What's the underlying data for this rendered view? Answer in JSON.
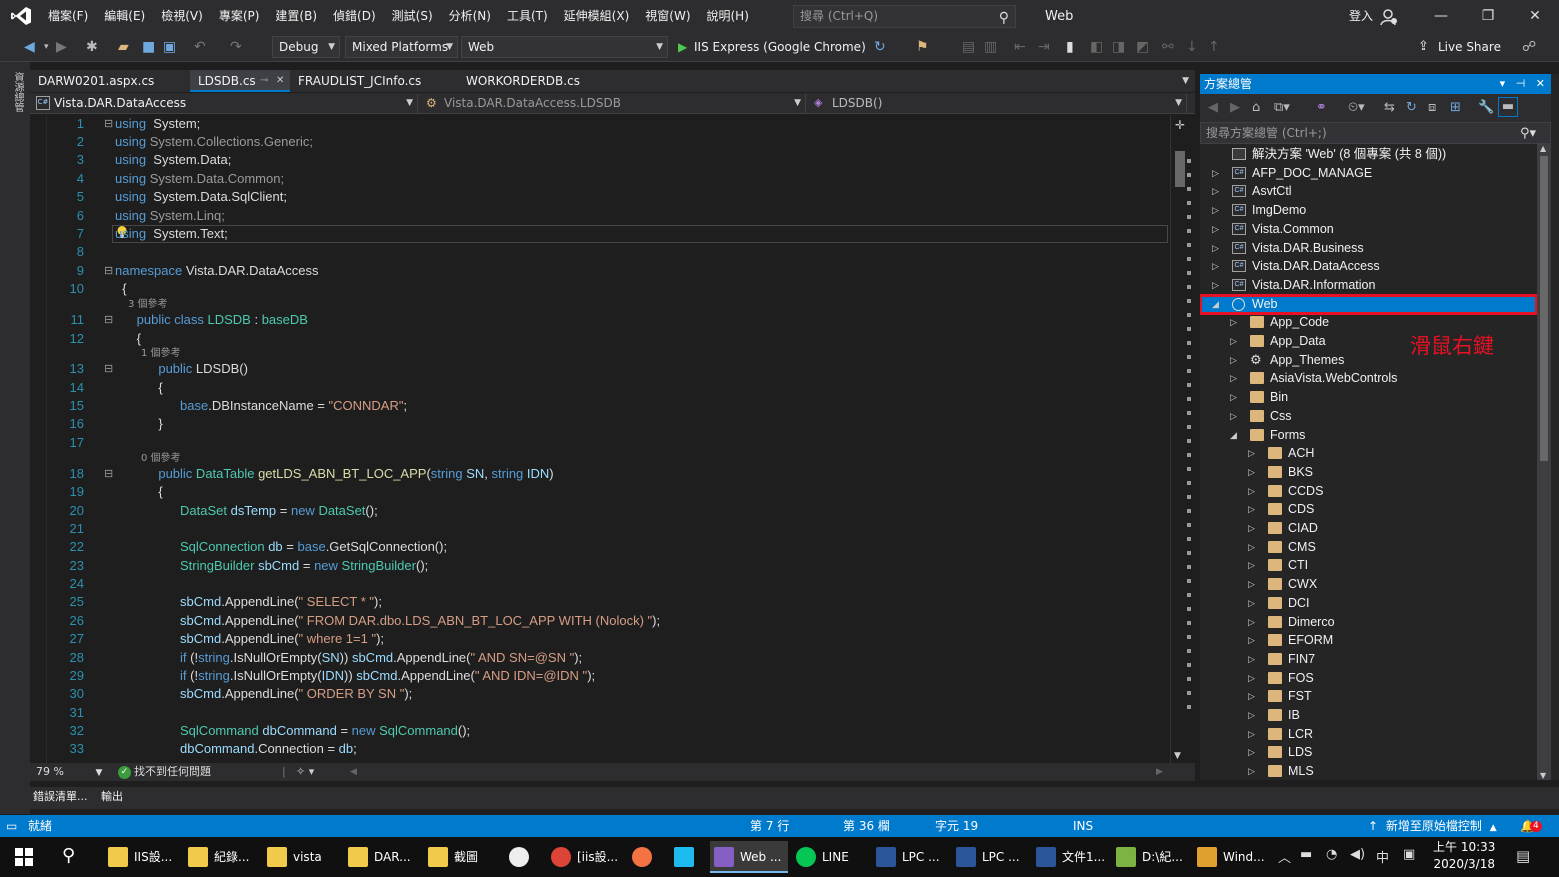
{
  "menubar": {
    "menus": [
      "檔案(F)",
      "編輯(E)",
      "檢視(V)",
      "專案(P)",
      "建置(B)",
      "偵錯(D)",
      "測試(S)",
      "分析(N)",
      "工具(T)",
      "延伸模組(X)",
      "視窗(W)",
      "說明(H)"
    ],
    "search_placeholder": "搜尋 (Ctrl+Q)",
    "solution_name": "Web",
    "signin_label": "登入"
  },
  "toolbar": {
    "config": "Debug",
    "platform": "Mixed Platforms",
    "startup_project": "Web",
    "run_label": "IIS Express (Google Chrome)",
    "liveshare_label": "Live Share"
  },
  "left_strip": {
    "toolbox_label": "資源總管"
  },
  "tabs": [
    {
      "label": "DARW0201.aspx.cs",
      "active": false
    },
    {
      "label": "LDSDB.cs",
      "active": true
    },
    {
      "label": "FRAUDLIST_JCInfo.cs",
      "active": false
    },
    {
      "label": "WORKORDERDB.cs",
      "active": false
    }
  ],
  "navbar": {
    "project": "Vista.DAR.DataAccess",
    "class": "Vista.DAR.DataAccess.LDSDB",
    "member": "LDSDB()"
  },
  "code_lines": [
    {
      "n": "1",
      "fold": "⊟",
      "parts": [
        [
          "kw",
          "using"
        ],
        [
          "",
          "  System;"
        ]
      ]
    },
    {
      "n": "2",
      "parts": [
        [
          "kw",
          "using"
        ],
        [
          "dim",
          " System.Collections.Generic;"
        ]
      ]
    },
    {
      "n": "3",
      "parts": [
        [
          "kw",
          "using"
        ],
        [
          "",
          "  System.Data;"
        ]
      ]
    },
    {
      "n": "4",
      "parts": [
        [
          "kw",
          "using"
        ],
        [
          "dim",
          " System.Data.Common;"
        ]
      ]
    },
    {
      "n": "5",
      "parts": [
        [
          "kw",
          "using"
        ],
        [
          "",
          "  System.Data.SqlClient;"
        ]
      ]
    },
    {
      "n": "6",
      "parts": [
        [
          "kw",
          "using"
        ],
        [
          "dim",
          " System.Linq;"
        ]
      ]
    },
    {
      "n": "7",
      "parts": [
        [
          "kw",
          "using"
        ],
        [
          "",
          "  System.Text;"
        ]
      ]
    },
    {
      "n": "8",
      "parts": []
    },
    {
      "n": "9",
      "fold": "⊟",
      "parts": [
        [
          "kw",
          "namespace"
        ],
        [
          "",
          " Vista.DAR.DataAccess"
        ]
      ]
    },
    {
      "n": "10",
      "parts": [
        [
          "",
          "  {"
        ]
      ]
    },
    {
      "n": "11",
      "fold": "⊟",
      "lens": "3 個參考",
      "parts": [
        [
          "kw",
          "      public class"
        ],
        [
          "ty",
          " LDSDB"
        ],
        [
          "",
          " : "
        ],
        [
          "ty",
          "baseDB"
        ]
      ]
    },
    {
      "n": "12",
      "parts": [
        [
          "",
          "      {"
        ]
      ]
    },
    {
      "n": "13",
      "fold": "⊟",
      "lens": "1 個參考",
      "parts": [
        [
          "kw",
          "            public"
        ],
        [
          "",
          " LDSDB()"
        ]
      ]
    },
    {
      "n": "14",
      "parts": [
        [
          "",
          "            {"
        ]
      ]
    },
    {
      "n": "15",
      "parts": [
        [
          "kw",
          "                  base"
        ],
        [
          "",
          ".DBInstanceName = "
        ],
        [
          "st",
          "\"CONNDAR\""
        ],
        [
          "",
          ";"
        ]
      ]
    },
    {
      "n": "16",
      "parts": [
        [
          "",
          "            }"
        ]
      ]
    },
    {
      "n": "17",
      "parts": []
    },
    {
      "n": "18",
      "fold": "⊟",
      "lens": "0 個參考",
      "parts": [
        [
          "kw",
          "            public"
        ],
        [
          "ty",
          " DataTable"
        ],
        [
          "fn",
          " getLDS_ABN_BT_LOC_APP"
        ],
        [
          "",
          "("
        ],
        [
          "kw",
          "string"
        ],
        [
          "vr",
          " SN"
        ],
        [
          "",
          ", "
        ],
        [
          "kw",
          "string"
        ],
        [
          "vr",
          " IDN"
        ],
        [
          "",
          ")"
        ]
      ]
    },
    {
      "n": "19",
      "parts": [
        [
          "",
          "            {"
        ]
      ]
    },
    {
      "n": "20",
      "parts": [
        [
          "ty",
          "                  DataSet"
        ],
        [
          "vr",
          " dsTemp"
        ],
        [
          "",
          " = "
        ],
        [
          "kw",
          "new"
        ],
        [
          "ty",
          " DataSet"
        ],
        [
          "",
          "();"
        ]
      ]
    },
    {
      "n": "21",
      "parts": []
    },
    {
      "n": "22",
      "parts": [
        [
          "ty",
          "                  SqlConnection"
        ],
        [
          "vr",
          " db"
        ],
        [
          "",
          " = "
        ],
        [
          "kw",
          "base"
        ],
        [
          "",
          ".GetSqlConnection();"
        ]
      ]
    },
    {
      "n": "23",
      "parts": [
        [
          "ty",
          "                  StringBuilder"
        ],
        [
          "vr",
          " sbCmd"
        ],
        [
          "",
          " = "
        ],
        [
          "kw",
          "new"
        ],
        [
          "ty",
          " StringBuilder"
        ],
        [
          "",
          "();"
        ]
      ]
    },
    {
      "n": "24",
      "parts": []
    },
    {
      "n": "25",
      "parts": [
        [
          "vr",
          "                  sbCmd"
        ],
        [
          "",
          ".AppendLine("
        ],
        [
          "st",
          "\" SELECT * \""
        ],
        [
          "",
          ");"
        ]
      ]
    },
    {
      "n": "26",
      "parts": [
        [
          "vr",
          "                  sbCmd"
        ],
        [
          "",
          ".AppendLine("
        ],
        [
          "st",
          "\" FROM DAR.dbo.LDS_ABN_BT_LOC_APP WITH (Nolock) \""
        ],
        [
          "",
          ");"
        ]
      ]
    },
    {
      "n": "27",
      "parts": [
        [
          "vr",
          "                  sbCmd"
        ],
        [
          "",
          ".AppendLine("
        ],
        [
          "st",
          "\" where 1=1 \""
        ],
        [
          "",
          ");"
        ]
      ]
    },
    {
      "n": "28",
      "parts": [
        [
          "kw",
          "                  if"
        ],
        [
          "",
          " (!"
        ],
        [
          "kw",
          "string"
        ],
        [
          "",
          ".IsNullOrEmpty("
        ],
        [
          "vr",
          "SN"
        ],
        [
          "",
          ")) "
        ],
        [
          "vr",
          "sbCmd"
        ],
        [
          "",
          ".AppendLine("
        ],
        [
          "st",
          "\" AND SN=@SN \""
        ],
        [
          "",
          ");"
        ]
      ]
    },
    {
      "n": "29",
      "parts": [
        [
          "kw",
          "                  if"
        ],
        [
          "",
          " (!"
        ],
        [
          "kw",
          "string"
        ],
        [
          "",
          ".IsNullOrEmpty("
        ],
        [
          "vr",
          "IDN"
        ],
        [
          "",
          ")) "
        ],
        [
          "vr",
          "sbCmd"
        ],
        [
          "",
          ".AppendLine("
        ],
        [
          "st",
          "\" AND IDN=@IDN \""
        ],
        [
          "",
          ");"
        ]
      ]
    },
    {
      "n": "30",
      "parts": [
        [
          "vr",
          "                  sbCmd"
        ],
        [
          "",
          ".AppendLine("
        ],
        [
          "st",
          "\" ORDER BY SN \""
        ],
        [
          "",
          ");"
        ]
      ]
    },
    {
      "n": "31",
      "parts": []
    },
    {
      "n": "32",
      "parts": [
        [
          "ty",
          "                  SqlCommand"
        ],
        [
          "vr",
          " dbCommand"
        ],
        [
          "",
          " = "
        ],
        [
          "kw",
          "new"
        ],
        [
          "ty",
          " SqlCommand"
        ],
        [
          "",
          "();"
        ]
      ]
    },
    {
      "n": "33",
      "parts": [
        [
          "vr",
          "                  dbCommand"
        ],
        [
          "",
          ".Connection = "
        ],
        [
          "vr",
          "db"
        ],
        [
          "",
          ";"
        ]
      ]
    }
  ],
  "editor_status": {
    "zoom": "79 %",
    "issues": "找不到任何問題"
  },
  "bottom_tabs": [
    "錯誤清單...",
    "輸出"
  ],
  "statusbar": {
    "ready": "就緒",
    "line": "第 7 行",
    "col": "第 36 欄",
    "char": "字元 19",
    "mode": "INS",
    "source_control": "新增至原始檔控制",
    "notifications": "4"
  },
  "solution_explorer": {
    "title": "方案總管",
    "search_placeholder": "搜尋方案總管 (Ctrl+;)",
    "annotation": "滑鼠右鍵",
    "nodes": [
      {
        "label": "解決方案 'Web' (8 個專案 (共 8 個))",
        "depth": 0,
        "icon": "solution",
        "arrow": ""
      },
      {
        "label": "AFP_DOC_MANAGE",
        "depth": 0,
        "icon": "csproj",
        "arrow": "▷"
      },
      {
        "label": "AsvtCtl",
        "depth": 0,
        "icon": "csproj",
        "arrow": "▷"
      },
      {
        "label": "ImgDemo",
        "depth": 0,
        "icon": "csproj",
        "arrow": "▷"
      },
      {
        "label": "Vista.Common",
        "depth": 0,
        "icon": "csproj",
        "arrow": "▷"
      },
      {
        "label": "Vista.DAR.Business",
        "depth": 0,
        "icon": "csproj",
        "arrow": "▷"
      },
      {
        "label": "Vista.DAR.DataAccess",
        "depth": 0,
        "icon": "csproj",
        "arrow": "▷"
      },
      {
        "label": "Vista.DAR.Information",
        "depth": 0,
        "icon": "csproj",
        "arrow": "▷"
      },
      {
        "label": "Web",
        "depth": 0,
        "icon": "web",
        "arrow": "◢",
        "selected": true
      },
      {
        "label": "App_Code",
        "depth": 1,
        "icon": "folder",
        "arrow": "▷"
      },
      {
        "label": "App_Data",
        "depth": 1,
        "icon": "folder",
        "arrow": "▷"
      },
      {
        "label": "App_Themes",
        "depth": 1,
        "icon": "gear",
        "arrow": "▷"
      },
      {
        "label": "AsiaVista.WebControls",
        "depth": 1,
        "icon": "folder",
        "arrow": "▷"
      },
      {
        "label": "Bin",
        "depth": 1,
        "icon": "folder",
        "arrow": "▷"
      },
      {
        "label": "Css",
        "depth": 1,
        "icon": "folder",
        "arrow": "▷"
      },
      {
        "label": "Forms",
        "depth": 1,
        "icon": "folder-open",
        "arrow": "◢"
      },
      {
        "label": "ACH",
        "depth": 2,
        "icon": "folder",
        "arrow": "▷"
      },
      {
        "label": "BKS",
        "depth": 2,
        "icon": "folder",
        "arrow": "▷"
      },
      {
        "label": "CCDS",
        "depth": 2,
        "icon": "folder",
        "arrow": "▷"
      },
      {
        "label": "CDS",
        "depth": 2,
        "icon": "folder",
        "arrow": "▷"
      },
      {
        "label": "CIAD",
        "depth": 2,
        "icon": "folder",
        "arrow": "▷"
      },
      {
        "label": "CMS",
        "depth": 2,
        "icon": "folder",
        "arrow": "▷"
      },
      {
        "label": "CTI",
        "depth": 2,
        "icon": "folder",
        "arrow": "▷"
      },
      {
        "label": "CWX",
        "depth": 2,
        "icon": "folder",
        "arrow": "▷"
      },
      {
        "label": "DCI",
        "depth": 2,
        "icon": "folder",
        "arrow": "▷"
      },
      {
        "label": "Dimerco",
        "depth": 2,
        "icon": "folder",
        "arrow": "▷"
      },
      {
        "label": "EFORM",
        "depth": 2,
        "icon": "folder",
        "arrow": "▷"
      },
      {
        "label": "FIN7",
        "depth": 2,
        "icon": "folder",
        "arrow": "▷"
      },
      {
        "label": "FOS",
        "depth": 2,
        "icon": "folder",
        "arrow": "▷"
      },
      {
        "label": "FST",
        "depth": 2,
        "icon": "folder",
        "arrow": "▷"
      },
      {
        "label": "IB",
        "depth": 2,
        "icon": "folder",
        "arrow": "▷"
      },
      {
        "label": "LCR",
        "depth": 2,
        "icon": "folder",
        "arrow": "▷"
      },
      {
        "label": "LDS",
        "depth": 2,
        "icon": "folder",
        "arrow": "▷"
      },
      {
        "label": "MLS",
        "depth": 2,
        "icon": "folder",
        "arrow": "▷"
      }
    ]
  },
  "taskbar": {
    "tasks": [
      {
        "label": "IIS設...",
        "icon": "folder"
      },
      {
        "label": "紀錄...",
        "icon": "folder"
      },
      {
        "label": "vista",
        "icon": "folder"
      },
      {
        "label": "DAR...",
        "icon": "folder"
      },
      {
        "label": "截圖",
        "icon": "folder"
      },
      {
        "label": "",
        "icon": "panda"
      },
      {
        "label": "[iis設...",
        "icon": "chrome"
      },
      {
        "label": "",
        "icon": "compass"
      },
      {
        "label": "",
        "icon": "ie"
      },
      {
        "label": "Web ...",
        "icon": "vs"
      },
      {
        "label": "LINE",
        "icon": "line"
      },
      {
        "label": "LPC ...",
        "icon": "word"
      },
      {
        "label": "LPC ...",
        "icon": "word"
      },
      {
        "label": "文件1...",
        "icon": "word"
      },
      {
        "label": "D:\\紀...",
        "icon": "notepad"
      },
      {
        "label": "Wind...",
        "icon": "snip"
      }
    ],
    "ime": "中",
    "time": "上午 10:33",
    "date": "2020/3/18"
  },
  "colors": {
    "accent": "#007acc",
    "highlight_box": "#e81123",
    "keyword": "#569cd6",
    "type": "#4ec9b0",
    "string": "#d69d85"
  }
}
